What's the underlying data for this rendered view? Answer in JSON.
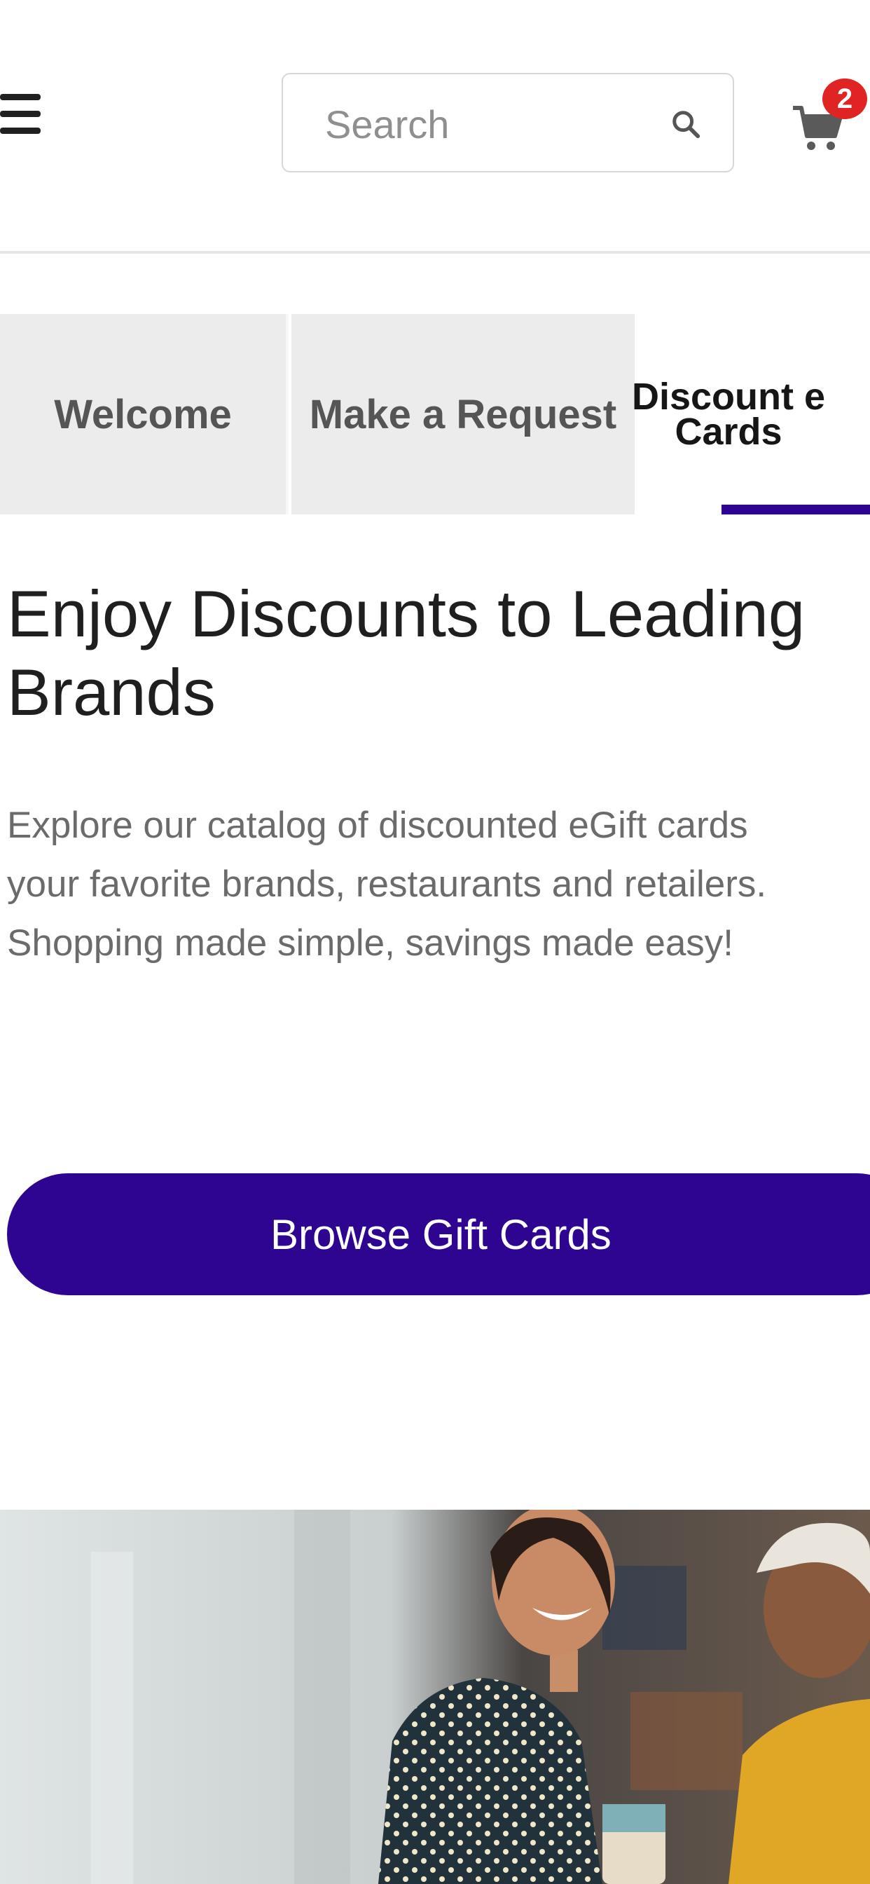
{
  "header": {
    "search_placeholder": "Search",
    "cart_count": "2",
    "icons": {
      "menu": "hamburger-menu-icon",
      "search": "search-icon",
      "cart": "shopping-cart-icon"
    }
  },
  "tabs": [
    {
      "label": "Welcome",
      "active": false
    },
    {
      "label": "Make a Request",
      "active": false
    },
    {
      "label": "Discount eGift Cards",
      "label_lines": [
        "Discount e",
        "Cards"
      ],
      "active": true
    }
  ],
  "main": {
    "heading": "Enjoy Discounts to Leading Brands",
    "description_lines": [
      "Explore our catalog of discounted eGift cards",
      "your favorite brands, restaurants and retailers.",
      "Shopping made simple, savings made easy!"
    ],
    "browse_button_label": "Browse Gift Cards"
  },
  "colors": {
    "accent": "#2e0590",
    "badge": "#e02424",
    "tab_inactive_bg": "#ececec",
    "heading_text": "#1f1f1f",
    "body_text": "#6b6b6b"
  }
}
